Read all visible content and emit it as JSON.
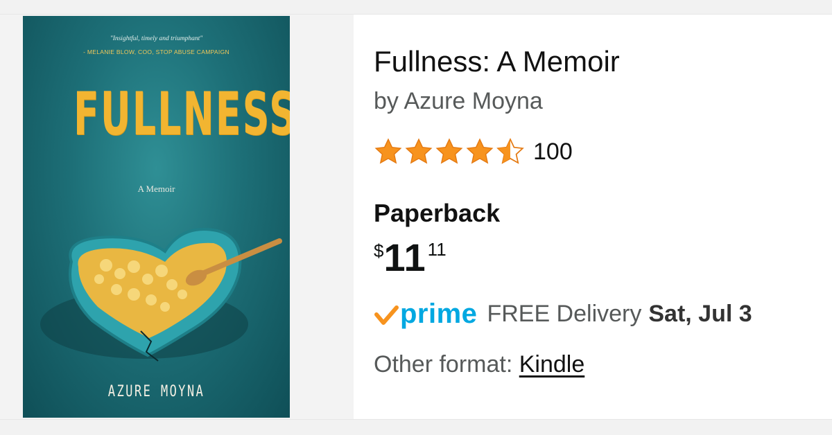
{
  "book": {
    "cover": {
      "quote": "\"Insightful, timely and triumphant\"",
      "attribution": "- MELANIE BLOW, COO, STOP ABUSE CAMPAIGN",
      "title": "FULLNESS",
      "subtitle": "A Memoir",
      "author": "AZURE MOYNA"
    },
    "title": "Fullness: A Memoir",
    "byline": "by Azure Moyna",
    "rating": {
      "stars_out_of_5": 4.5,
      "count": "100"
    },
    "format": "Paperback",
    "price": {
      "symbol": "$",
      "whole": "11",
      "fraction": "11"
    },
    "delivery": {
      "badge": "prime",
      "label": "FREE Delivery",
      "date": "Sat, Jul 3"
    },
    "other_format": {
      "label": "Other format:",
      "link": "Kindle"
    }
  },
  "colors": {
    "star": "#f7931e",
    "prime": "#00a8e1",
    "prime_check": "#f7931e",
    "cover_teal": "#1d6f77",
    "cover_title": "#f2b531"
  },
  "icons": [
    "star-icon",
    "half-star-icon",
    "prime-check-icon"
  ]
}
